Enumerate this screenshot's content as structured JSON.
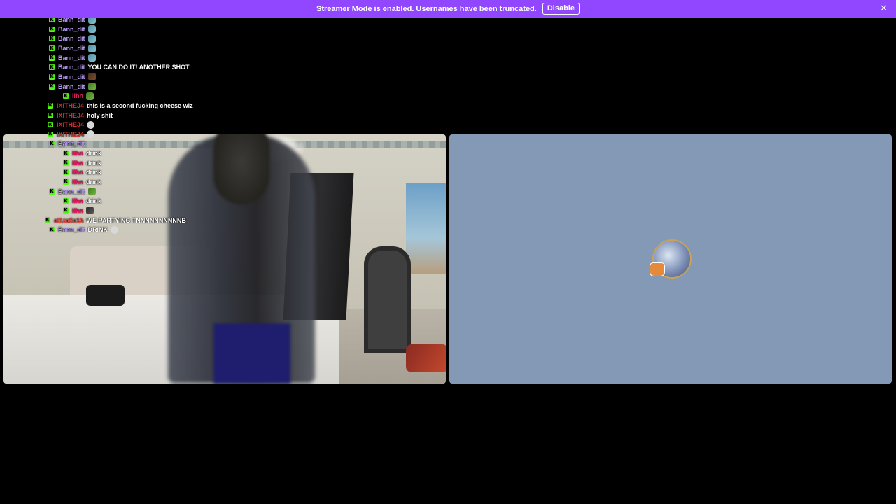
{
  "banner": {
    "message": "Streamer Mode is enabled. Usernames have been truncated.",
    "disable_label": "Disable",
    "close_glyph": "✕",
    "background": "#9146ff"
  },
  "colors": {
    "page_background": "#000000",
    "badge": "#53fc18",
    "avatar_tile": "#8399b6"
  },
  "chat": {
    "messages": [
      {
        "username": "llhn",
        "text": "",
        "emote": "dark-emote",
        "username_color": "#e91e63",
        "indent": 90
      },
      {
        "username": "llhn",
        "text": "",
        "emote": "dark-emote",
        "username_color": "#e91e63",
        "indent": 90
      },
      {
        "username": "Bann_dit",
        "text": "",
        "emote": "fish-emote",
        "username_color": "#b89cf5",
        "indent": 70
      },
      {
        "username": "Bann_dit",
        "text": "",
        "emote": "fish-emote",
        "username_color": "#b89cf5",
        "indent": 70
      },
      {
        "username": "Bann_dit",
        "text": "",
        "emote": "fish-emote",
        "username_color": "#b89cf5",
        "indent": 70
      },
      {
        "username": "Bann_dit",
        "text": "",
        "emote": "fish-emote",
        "username_color": "#b89cf5",
        "indent": 70
      },
      {
        "username": "Bann_dit",
        "text": "",
        "emote": "fish-emote",
        "username_color": "#b89cf5",
        "indent": 70
      },
      {
        "username": "Bann_dit",
        "text": "YOU CAN DO IT! ANOTHER SHOT",
        "emote": "",
        "username_color": "#b89cf5",
        "indent": 70
      },
      {
        "username": "Bann_dit",
        "text": "",
        "emote": "brown-emote",
        "username_color": "#b89cf5",
        "indent": 70
      },
      {
        "username": "Bann_dit",
        "text": "",
        "emote": "green-emote",
        "username_color": "#b89cf5",
        "indent": 70
      },
      {
        "username": "llhn",
        "text": "",
        "emote": "green-emote",
        "username_color": "#e91e63",
        "indent": 90
      },
      {
        "username": "IXITHEJ4",
        "text": "this is a second fucking cheese wiz",
        "emote": "",
        "username_color": "#d32f2f",
        "indent": 68
      },
      {
        "username": "IXITHEJ4",
        "text": "holy shit",
        "emote": "",
        "username_color": "#d32f2f",
        "indent": 68
      },
      {
        "username": "IXITHEJ4",
        "text": "",
        "emote": "bubble-emote",
        "username_color": "#d32f2f",
        "indent": 68
      },
      {
        "username": "IXITHEJ4",
        "text": "",
        "emote": "bubble-emote",
        "username_color": "#d32f2f",
        "indent": 68
      },
      {
        "username": "Bann_dit",
        "text": "",
        "emote": "",
        "username_color": "#b89cf5",
        "indent": 70
      },
      {
        "username": "llhn",
        "text": "drink",
        "emote": "",
        "username_color": "#e91e63",
        "indent": 90
      },
      {
        "username": "llhn",
        "text": "drink",
        "emote": "",
        "username_color": "#e91e63",
        "indent": 90
      },
      {
        "username": "llhn",
        "text": "drink",
        "emote": "",
        "username_color": "#e91e63",
        "indent": 90
      },
      {
        "username": "llhn",
        "text": "drink",
        "emote": "",
        "username_color": "#e91e63",
        "indent": 90
      },
      {
        "username": "Bann_dit",
        "text": "",
        "emote": "green-emote",
        "username_color": "#b89cf5",
        "indent": 70
      },
      {
        "username": "llhn",
        "text": "drink",
        "emote": "",
        "username_color": "#e91e63",
        "indent": 90
      },
      {
        "username": "llhn",
        "text": "",
        "emote": "dark-emote",
        "username_color": "#e91e63",
        "indent": 90
      },
      {
        "username": "el1za5e1h",
        "text": "WE PARTYING TNNNNNNNNNNB",
        "emote": "",
        "username_color": "#e8554e",
        "indent": 64
      },
      {
        "username": "Bann_dit",
        "text": "DRINK",
        "emote": "bubble-emote",
        "username_color": "#b89cf5",
        "indent": 70
      }
    ]
  },
  "stage": {
    "camera_tile_label": "camera-feed",
    "avatar_tile_label": "avatar-placeholder"
  }
}
